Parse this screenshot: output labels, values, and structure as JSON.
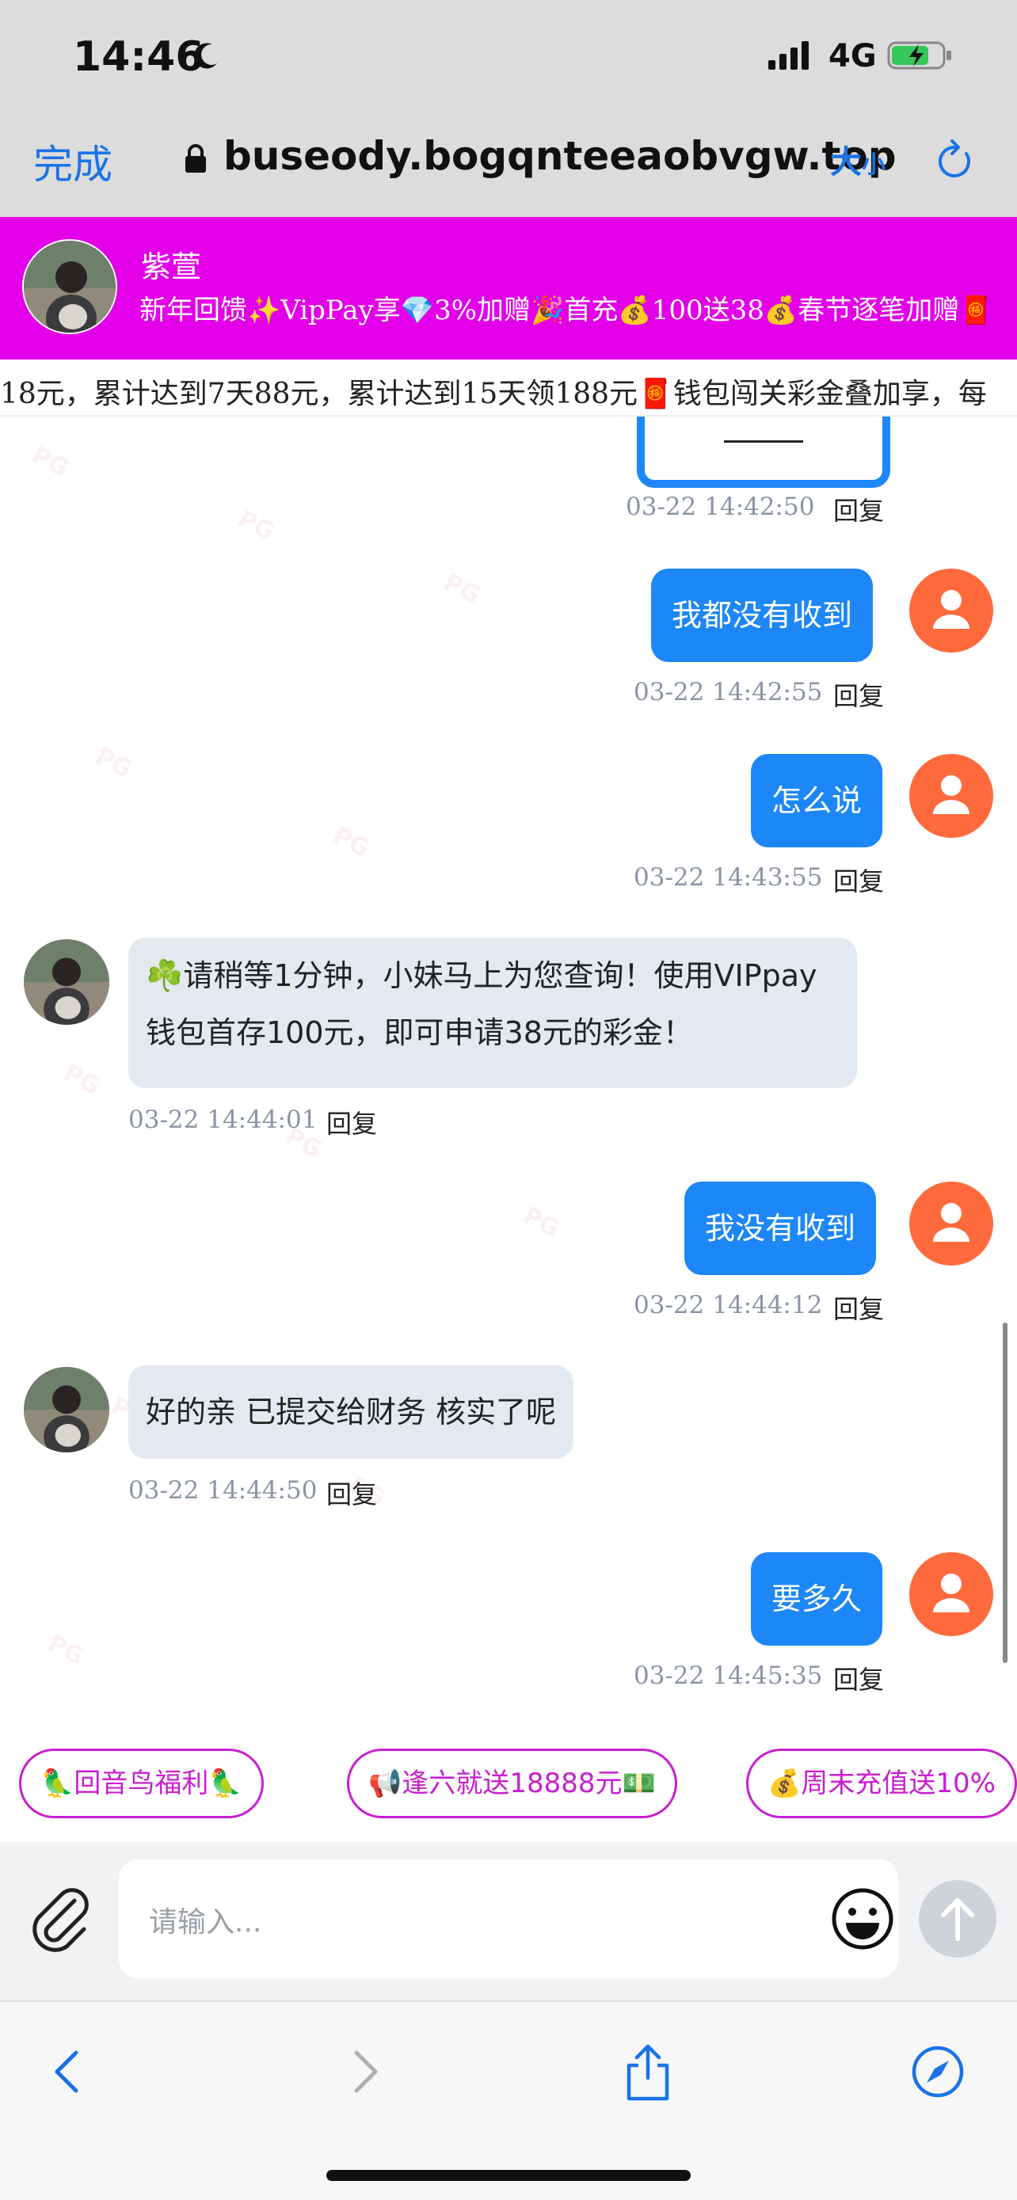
{
  "status_bar": {
    "time": "14:46",
    "network": "4G"
  },
  "browser": {
    "done_label": "完成",
    "url": "buseody.bogqnteeaobvgw.top",
    "text_size_big": "大",
    "text_size_small": "小"
  },
  "contact": {
    "name": "紫萱",
    "promo": "新年回馈✨VipPay享💎3%加赠🎉首充💰100送38💰春节逐笔加赠🧧"
  },
  "marquee": "18元，累计达到7天88元，累计达到15天领188元🧧钱包闯关彩金叠加享，每",
  "messages": [
    {
      "id": "m0",
      "side": "me",
      "time": "03-22 14:42:50",
      "reply": "回复"
    },
    {
      "id": "m1",
      "side": "me",
      "text": "我都没有收到",
      "time": "03-22 14:42:55",
      "reply": "回复"
    },
    {
      "id": "m2",
      "side": "me",
      "text": "怎么说",
      "time": "03-22 14:43:55",
      "reply": "回复"
    },
    {
      "id": "m3",
      "side": "them",
      "text": "☘️请稍等1分钟，小妹马上为您查询！使用VIPpay钱包首存100元，即可申请38元的彩金！",
      "time": "03-22 14:44:01",
      "reply": "回复"
    },
    {
      "id": "m4",
      "side": "me",
      "text": "我没有收到",
      "time": "03-22 14:44:12",
      "reply": "回复"
    },
    {
      "id": "m5",
      "side": "them",
      "text": "好的亲 已提交给财务 核实了呢",
      "time": "03-22 14:44:50",
      "reply": "回复"
    },
    {
      "id": "m6",
      "side": "me",
      "text": "要多久",
      "time": "03-22 14:45:35",
      "reply": "回复"
    }
  ],
  "quick_chips": [
    "🦜回音鸟福利🦜",
    "📢逢六就送18888元💵",
    "💰周末充值送10%"
  ],
  "input": {
    "placeholder": "请输入..."
  },
  "icons": {
    "attach": "paperclip-icon",
    "emoji": "smiley-icon",
    "send": "arrow-up-icon",
    "back": "chevron-left-icon",
    "forward": "chevron-right-icon",
    "share": "share-icon",
    "compass": "compass-icon"
  },
  "colors": {
    "accent_blue": "#1d87f7",
    "header_magenta": "#e300e8",
    "chip_magenta": "#c81fd1",
    "user_avatar": "#ff6a3d"
  }
}
